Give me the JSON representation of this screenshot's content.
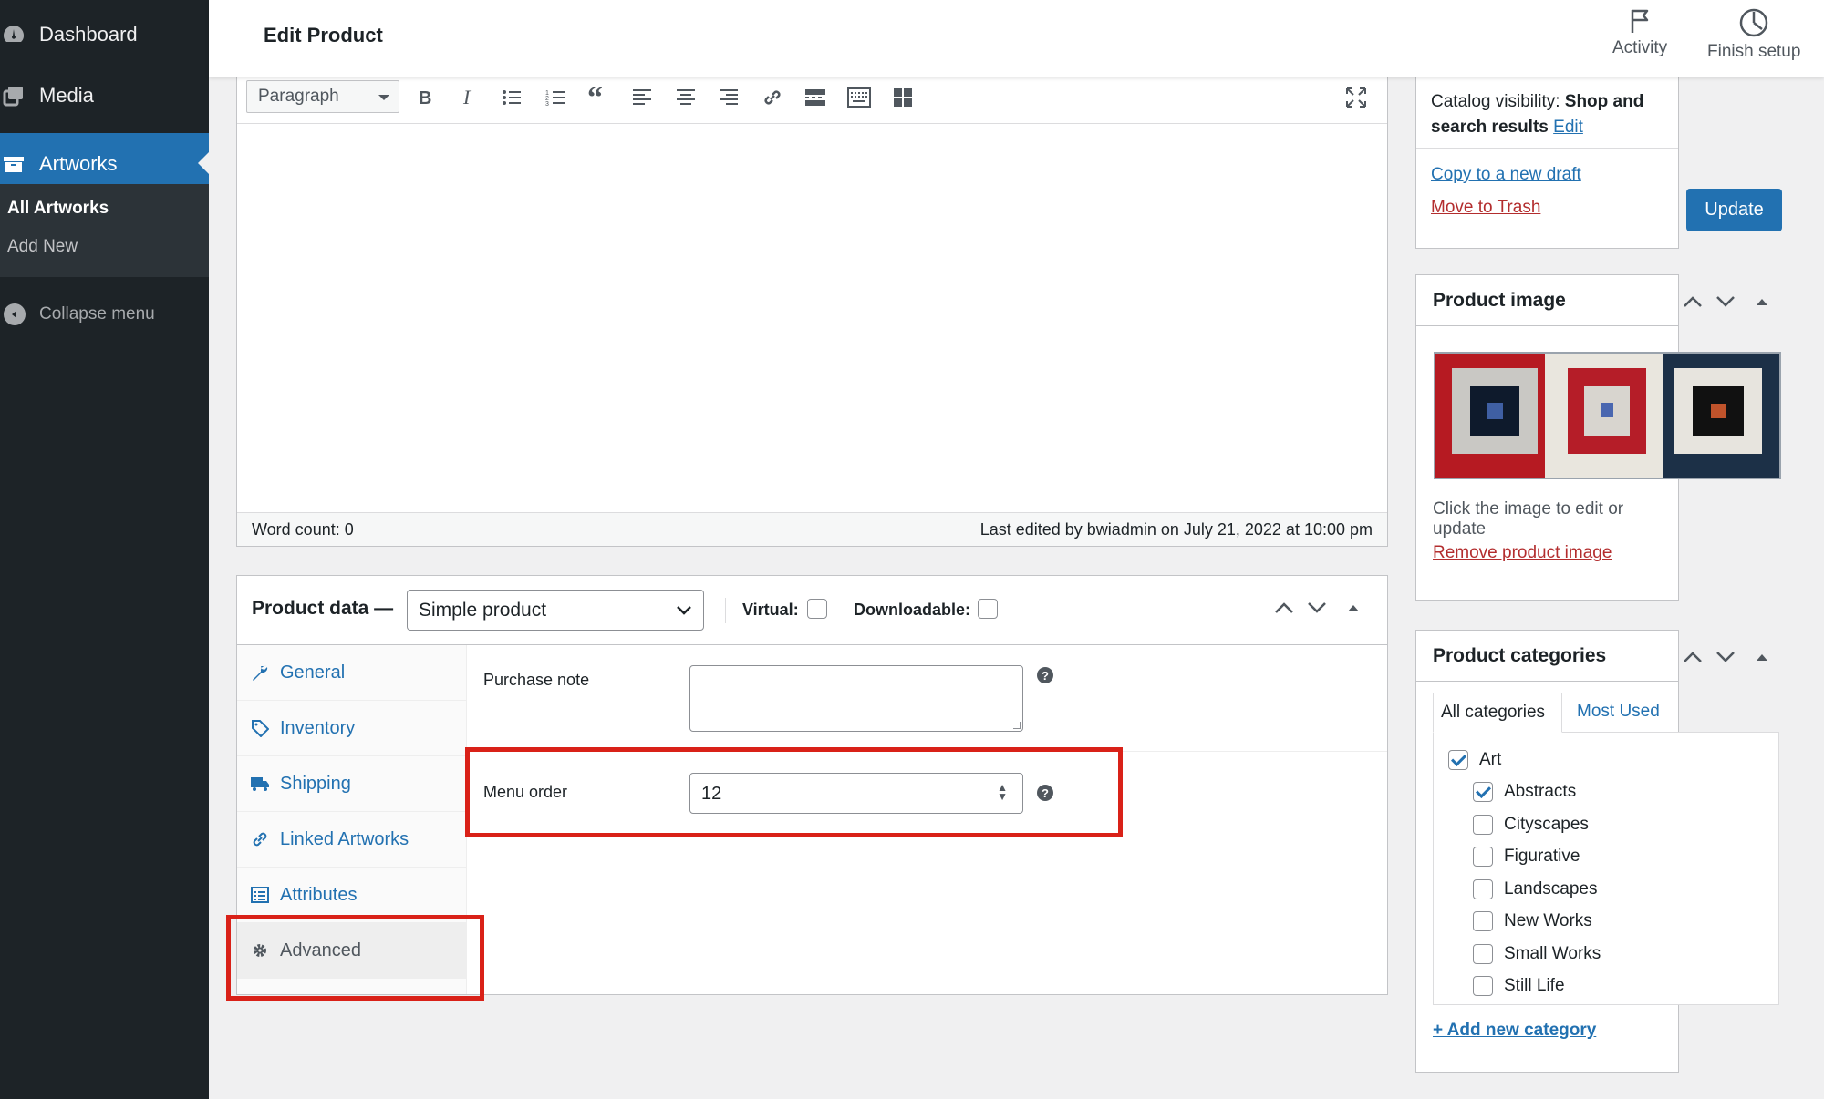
{
  "sidebar": {
    "items": [
      {
        "label": "Dashboard",
        "icon": "dashboard-icon"
      },
      {
        "label": "Media",
        "icon": "media-icon"
      },
      {
        "label": "Artworks",
        "icon": "archive-icon",
        "current": true
      }
    ],
    "submenu": [
      {
        "label": "All Artworks",
        "current": true
      },
      {
        "label": "Add New",
        "current": false
      }
    ],
    "collapse_label": "Collapse menu"
  },
  "header": {
    "title": "Edit Product",
    "actions": [
      {
        "label": "Activity",
        "icon": "flag-icon"
      },
      {
        "label": "Finish setup",
        "icon": "progress-circle-icon"
      }
    ]
  },
  "editor": {
    "format": "Paragraph",
    "toolbar_icons": [
      "bold-icon",
      "italic-icon",
      "bullet-list-icon",
      "numbered-list-icon",
      "blockquote-icon",
      "align-left-icon",
      "align-center-icon",
      "align-right-icon",
      "link-icon",
      "read-more-icon",
      "toolbar-toggle-icon",
      "blocks-icon",
      "fullscreen-icon"
    ],
    "word_count": "Word count: 0",
    "last_edited": "Last edited by bwiadmin on July 21, 2022 at 10:00 pm"
  },
  "product_data": {
    "title": "Product data —",
    "type": "Simple product",
    "virtual_label": "Virtual:",
    "virtual_checked": false,
    "downloadable_label": "Downloadable:",
    "downloadable_checked": false,
    "tabs": [
      {
        "label": "General",
        "icon": "wrench-icon"
      },
      {
        "label": "Inventory",
        "icon": "tag-icon"
      },
      {
        "label": "Shipping",
        "icon": "truck-icon"
      },
      {
        "label": "Linked Artworks",
        "icon": "link-icon"
      },
      {
        "label": "Attributes",
        "icon": "list-icon"
      },
      {
        "label": "Advanced",
        "icon": "gear-icon",
        "active": true
      }
    ],
    "purchase_note_label": "Purchase note",
    "purchase_note_value": "",
    "menu_order_label": "Menu order",
    "menu_order_value": "12",
    "help_icon": "?"
  },
  "publish": {
    "catalog_label": "Catalog visibility:",
    "catalog_value": "Shop and search results",
    "edit_link": "Edit",
    "copy_draft": "Copy to a new draft",
    "move_trash": "Move to Trash",
    "update_button": "Update"
  },
  "product_image": {
    "title": "Product image",
    "hint": "Click the image to edit or update",
    "remove_link": "Remove product image"
  },
  "categories": {
    "title": "Product categories",
    "tabs": [
      "All categories",
      "Most Used"
    ],
    "items": [
      {
        "label": "Art",
        "checked": true,
        "level": 0
      },
      {
        "label": "Abstracts",
        "checked": true,
        "level": 1
      },
      {
        "label": "Cityscapes",
        "checked": false,
        "level": 1
      },
      {
        "label": "Figurative",
        "checked": false,
        "level": 1
      },
      {
        "label": "Landscapes",
        "checked": false,
        "level": 1
      },
      {
        "label": "New Works",
        "checked": false,
        "level": 1
      },
      {
        "label": "Small Works",
        "checked": false,
        "level": 1
      },
      {
        "label": "Still Life",
        "checked": false,
        "level": 1
      }
    ],
    "add_link": "+ Add new category"
  },
  "colors": {
    "sidebar_bg": "#1d2327",
    "accent": "#2271b1",
    "highlight": "#d92118",
    "danger_link": "#b32d2e"
  }
}
